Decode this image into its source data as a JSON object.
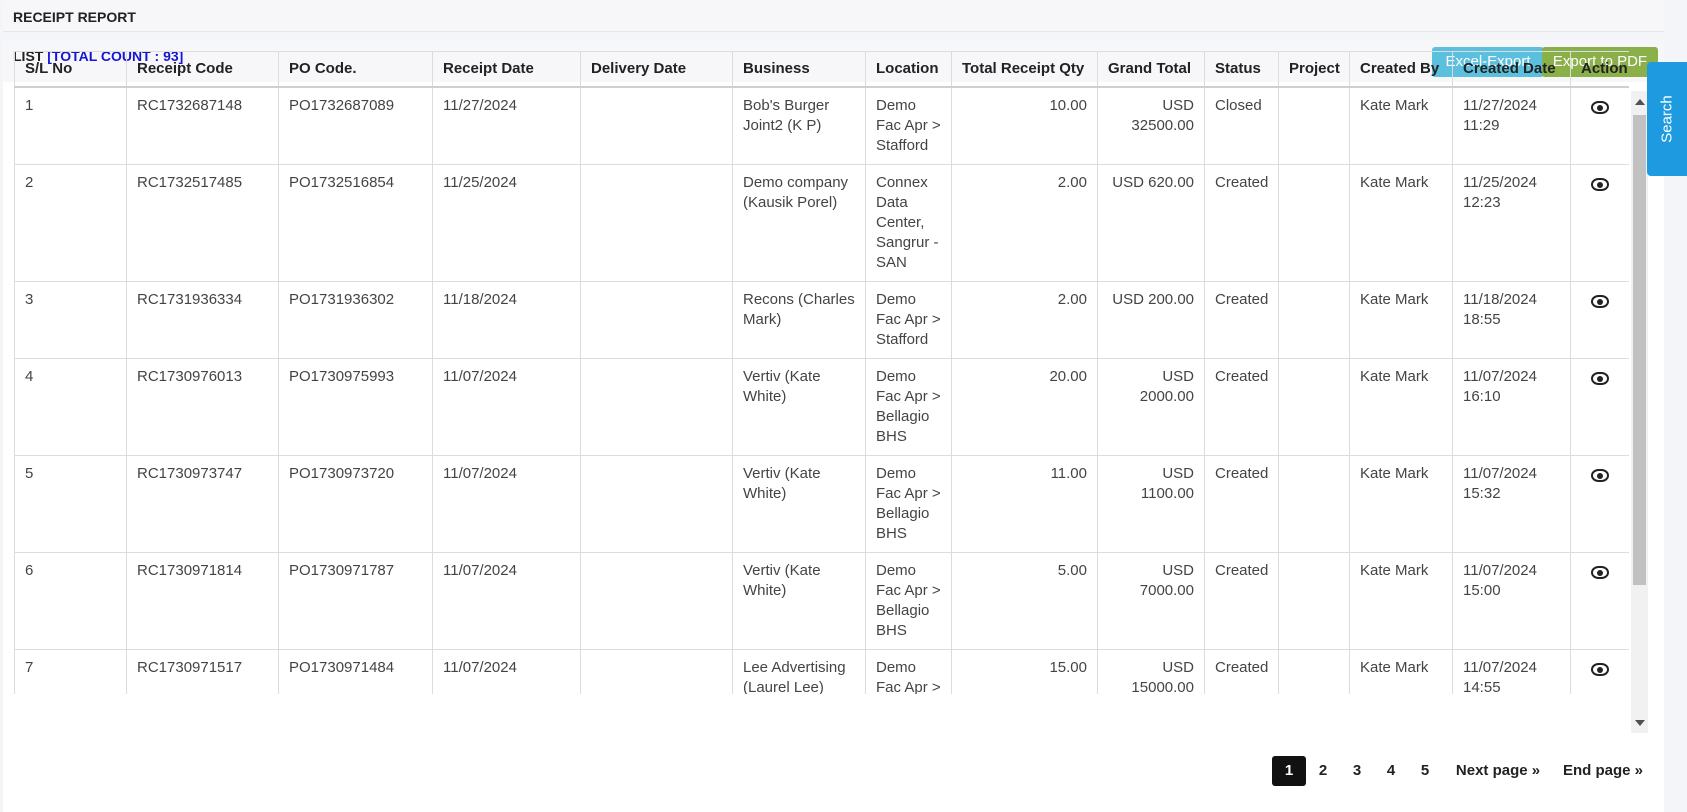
{
  "header": {
    "title": "RECEIPT REPORT"
  },
  "list": {
    "title": "LIST",
    "count_label": "[TOTAL COUNT : 93]"
  },
  "buttons": {
    "excel": "Excel-Export",
    "pdf": "Export to PDF",
    "search": "Search"
  },
  "colors": {
    "excel": "#5bc0de",
    "pdf": "#8bb04a",
    "search": "#1e9be0",
    "count": "#1515d6"
  },
  "table": {
    "columns": [
      "S/L No",
      "Receipt Code",
      "PO Code.",
      "Receipt Date",
      "Delivery Date",
      "Business",
      "Location",
      "Total Receipt Qty",
      "Grand Total",
      "Status",
      "Project",
      "Created By",
      "Created Date",
      "Action"
    ],
    "rows": [
      {
        "sl": "1",
        "receipt": "RC1732687148",
        "po": "PO1732687089",
        "rdate": "11/27/2024",
        "ddate": "",
        "business": "Bob's Burger Joint2 (K P)",
        "location": "Demo Fac Apr > Stafford",
        "qty": "10.00",
        "total": "USD 32500.00",
        "status": "Closed",
        "project": "",
        "created_by": "Kate Mark",
        "created_date": "11/27/2024 11:29",
        "action_icon": "eye-icon"
      },
      {
        "sl": "2",
        "receipt": "RC1732517485",
        "po": "PO1732516854",
        "rdate": "11/25/2024",
        "ddate": "",
        "business": "Demo company (Kausik Porel)",
        "location": "Connex Data Center, Sangrur - SAN",
        "qty": "2.00",
        "total": "USD 620.00",
        "status": "Created",
        "project": "",
        "created_by": "Kate Mark",
        "created_date": "11/25/2024 12:23",
        "action_icon": "eye-icon"
      },
      {
        "sl": "3",
        "receipt": "RC1731936334",
        "po": "PO1731936302",
        "rdate": "11/18/2024",
        "ddate": "",
        "business": "Recons (Charles Mark)",
        "location": "Demo Fac Apr > Stafford",
        "qty": "2.00",
        "total": "USD 200.00",
        "status": "Created",
        "project": "",
        "created_by": "Kate Mark",
        "created_date": "11/18/2024 18:55",
        "action_icon": "eye-icon"
      },
      {
        "sl": "4",
        "receipt": "RC1730976013",
        "po": "PO1730975993",
        "rdate": "11/07/2024",
        "ddate": "",
        "business": "Vertiv (Kate White)",
        "location": "Demo Fac Apr > Bellagio BHS",
        "qty": "20.00",
        "total": "USD 2000.00",
        "status": "Created",
        "project": "",
        "created_by": "Kate Mark",
        "created_date": "11/07/2024 16:10",
        "action_icon": "eye-icon"
      },
      {
        "sl": "5",
        "receipt": "RC1730973747",
        "po": "PO1730973720",
        "rdate": "11/07/2024",
        "ddate": "",
        "business": "Vertiv (Kate White)",
        "location": "Demo Fac Apr > Bellagio BHS",
        "qty": "11.00",
        "total": "USD 1100.00",
        "status": "Created",
        "project": "",
        "created_by": "Kate Mark",
        "created_date": "11/07/2024 15:32",
        "action_icon": "eye-icon"
      },
      {
        "sl": "6",
        "receipt": "RC1730971814",
        "po": "PO1730971787",
        "rdate": "11/07/2024",
        "ddate": "",
        "business": "Vertiv (Kate White)",
        "location": "Demo Fac Apr > Bellagio BHS",
        "qty": "5.00",
        "total": "USD 7000.00",
        "status": "Created",
        "project": "",
        "created_by": "Kate Mark",
        "created_date": "11/07/2024 15:00",
        "action_icon": "eye-icon"
      },
      {
        "sl": "7",
        "receipt": "RC1730971517",
        "po": "PO1730971484",
        "rdate": "11/07/2024",
        "ddate": "",
        "business": "Lee Advertising (Laurel Lee)",
        "location": "Demo Fac Apr > Bellagio BHS",
        "qty": "15.00",
        "total": "USD 15000.00",
        "status": "Created",
        "project": "",
        "created_by": "Kate Mark",
        "created_date": "11/07/2024 14:55",
        "action_icon": "eye-icon"
      }
    ]
  },
  "pagination": {
    "pages": [
      "1",
      "2",
      "3",
      "4",
      "5"
    ],
    "current": "1",
    "next": "Next page »",
    "end": "End page »"
  }
}
